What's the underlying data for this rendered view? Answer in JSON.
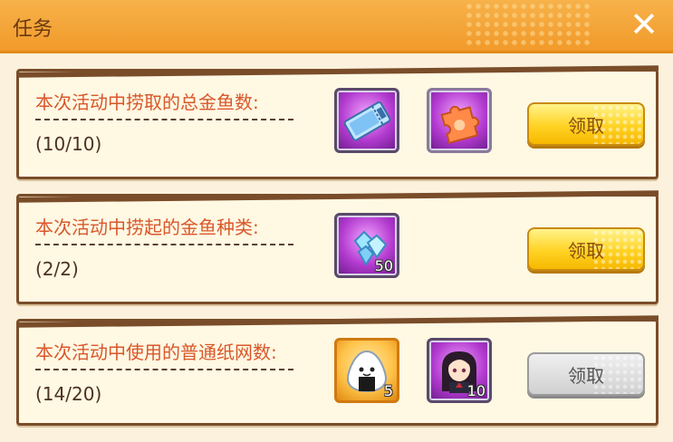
{
  "header": {
    "title": "任务"
  },
  "missions": [
    {
      "description": "本次活动中捞取的总金鱼数:",
      "progress": "(10/10)",
      "rewards": [
        {
          "icon": "ticket-icon",
          "count": ""
        },
        {
          "icon": "puzzle-piece-icon",
          "count": ""
        }
      ],
      "button_label": "领取",
      "button_state": "active"
    },
    {
      "description": "本次活动中捞起的金鱼种类:",
      "progress": "(2/2)",
      "rewards": [
        {
          "icon": "crystal-gems-icon",
          "count": "50"
        }
      ],
      "button_label": "领取",
      "button_state": "active"
    },
    {
      "description": "本次活动中使用的普通纸网数:",
      "progress": "(14/20)",
      "rewards": [
        {
          "icon": "rice-ball-icon",
          "count": "5"
        },
        {
          "icon": "character-portrait-icon",
          "count": "10"
        }
      ],
      "button_label": "领取",
      "button_state": "disabled"
    }
  ],
  "colors": {
    "header": "#f4a73c",
    "description_text": "#d9572a",
    "button_active": "#ffd324",
    "button_disabled": "#d0d0d0"
  }
}
